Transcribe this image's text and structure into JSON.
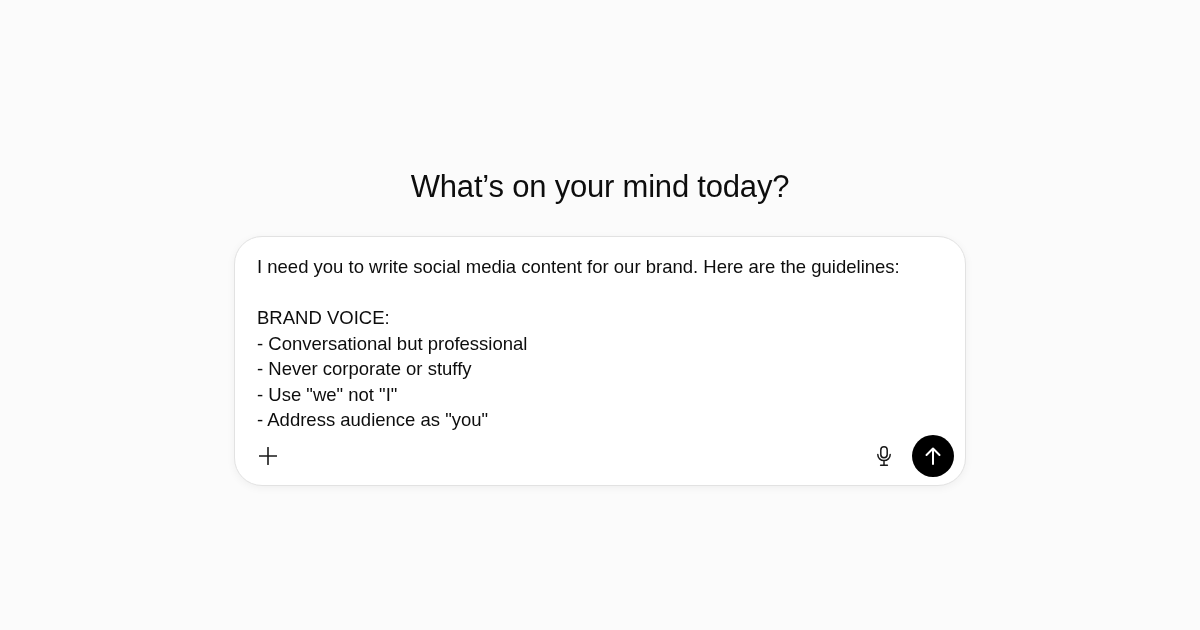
{
  "heading": "What’s on your mind today?",
  "composer": {
    "value": "I need you to write social media content for our brand. Here are the guidelines:\n\nBRAND VOICE:\n- Conversational but professional\n- Never corporate or stuffy\n- Use \"we\" not \"I\"\n- Address audience as \"you\"",
    "send_button": {
      "disabled": false
    }
  }
}
